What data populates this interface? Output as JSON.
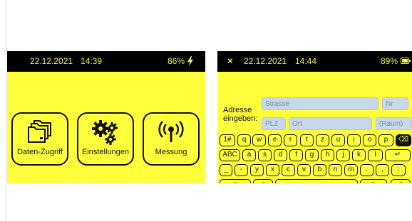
{
  "screen1": {
    "status": {
      "date": "22.12.2021",
      "time": "14:39",
      "battery": "86%"
    },
    "tiles": [
      {
        "label": "Daten-Zugriff",
        "icon": "folders-icon"
      },
      {
        "label": "Einstellungen",
        "icon": "gears-icon"
      },
      {
        "label": "Messung",
        "icon": "antenna-icon"
      }
    ]
  },
  "screen2": {
    "status": {
      "close": "×",
      "date": "22.12.2021",
      "time": "14:44",
      "battery": "89%"
    },
    "address_label_line1": "Adresse",
    "address_label_line2": "eingeben:",
    "fields": {
      "strasse": "Strasse",
      "nr": "Nr",
      "plz": "PLZ",
      "ort": "Ort",
      "raum": "(Raum)"
    },
    "keyboard": {
      "row1": [
        "1#",
        "q",
        "w",
        "e",
        "r",
        "t",
        "z",
        "u",
        "i",
        "o",
        "p",
        "⌫"
      ],
      "row2": [
        "ABC",
        "a",
        "s",
        "d",
        "f",
        "g",
        "h",
        "j",
        "k",
        "l",
        "↵"
      ],
      "row3": [
        "_",
        "-",
        "y",
        "x",
        "c",
        "v",
        "b",
        "n",
        "m",
        ".",
        ",",
        ":"
      ],
      "row4": [
        "×",
        "<",
        "",
        ">",
        "✓"
      ]
    }
  },
  "colors": {
    "accent": "#ffff3b",
    "status_bg": "#000000",
    "field_bg": "#c8d8ea"
  }
}
